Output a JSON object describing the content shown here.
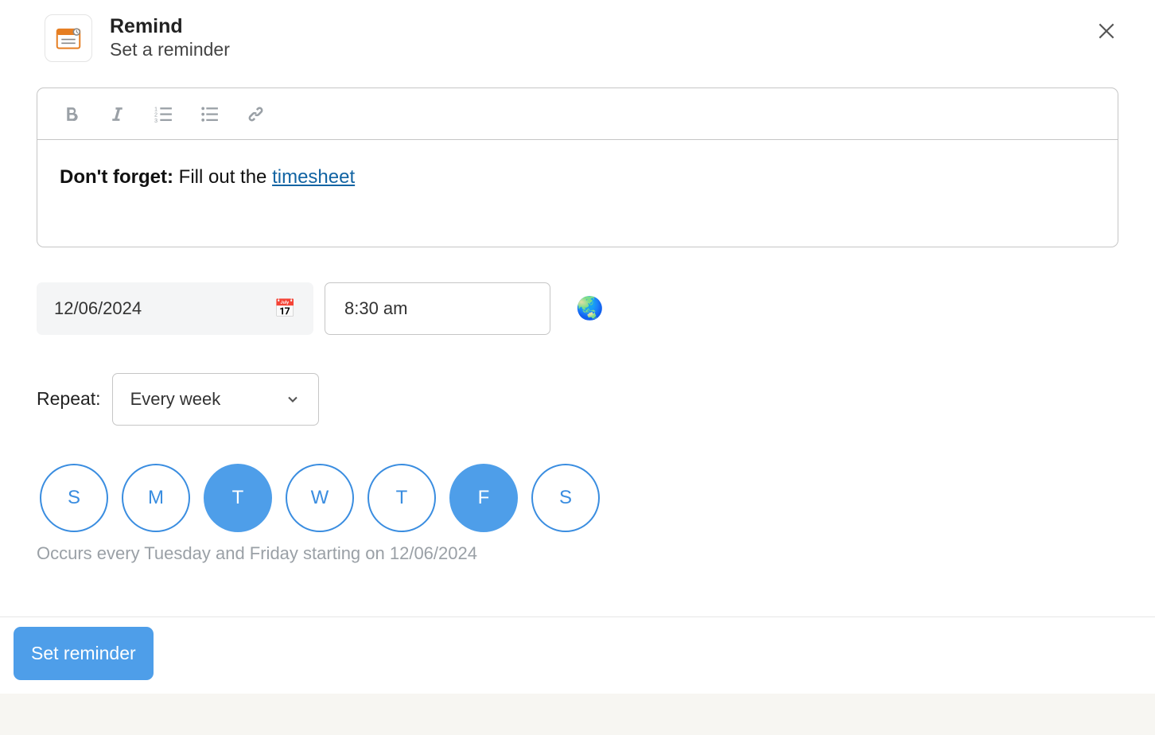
{
  "header": {
    "title": "Remind",
    "subtitle": "Set a reminder"
  },
  "content": {
    "lead": "Don't forget:",
    "body": " Fill out the ",
    "link": "timesheet"
  },
  "date": {
    "value": "12/06/2024",
    "emoji": "📅"
  },
  "time": {
    "value": "8:30 am"
  },
  "globe": "🌏",
  "repeat": {
    "label": "Repeat:",
    "value": "Every week"
  },
  "days": [
    {
      "label": "S",
      "selected": false
    },
    {
      "label": "M",
      "selected": false
    },
    {
      "label": "T",
      "selected": true
    },
    {
      "label": "W",
      "selected": false
    },
    {
      "label": "T",
      "selected": false
    },
    {
      "label": "F",
      "selected": true
    },
    {
      "label": "S",
      "selected": false
    }
  ],
  "occurs": "Occurs every Tuesday and Friday starting on 12/06/2024",
  "submit": "Set reminder"
}
